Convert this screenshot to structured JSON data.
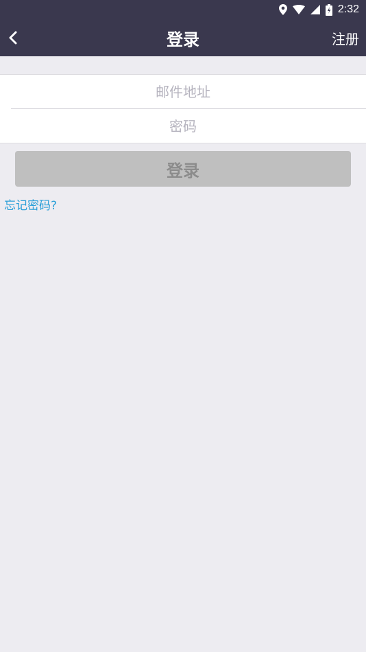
{
  "status_bar": {
    "time": "2:32"
  },
  "navbar": {
    "title": "登录",
    "register_label": "注册"
  },
  "form": {
    "email_placeholder": "邮件地址",
    "password_placeholder": "密码"
  },
  "login_button": "登录",
  "forgot_password": "忘记密码?"
}
